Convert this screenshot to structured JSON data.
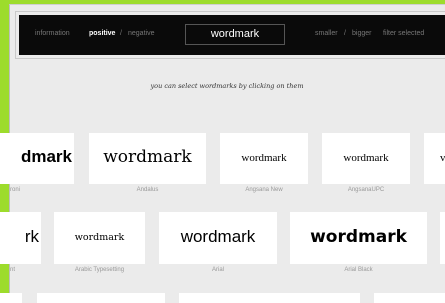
{
  "toolbar": {
    "information": "information",
    "positive": "positive",
    "sep1": "/",
    "negative": "negative",
    "search_value": "wordmark",
    "smaller": "smaller",
    "sep2": "/",
    "bigger": "bigger",
    "filter_selected": "filter selected"
  },
  "hint": "you can select wordmarks by clicking on them",
  "fonts": [
    {
      "sample": "dmark",
      "name": "roni"
    },
    {
      "sample": "wordmark",
      "name": "Andalus"
    },
    {
      "sample": "wordmark",
      "name": "Angsana New"
    },
    {
      "sample": "wordmark",
      "name": "AngsanaUPC"
    },
    {
      "sample": "v",
      "name": ""
    },
    {
      "sample": "rk",
      "name": "nt"
    },
    {
      "sample": "wordmark",
      "name": "Arabic Typesetting"
    },
    {
      "sample": "wordmark",
      "name": "Arial"
    },
    {
      "sample": "wordmark",
      "name": "Arial Black"
    }
  ],
  "colors": {
    "frame_green": "#9ddc2c",
    "page_bg": "#ebebeb",
    "toolbar_bg": "#0a0a0a"
  }
}
